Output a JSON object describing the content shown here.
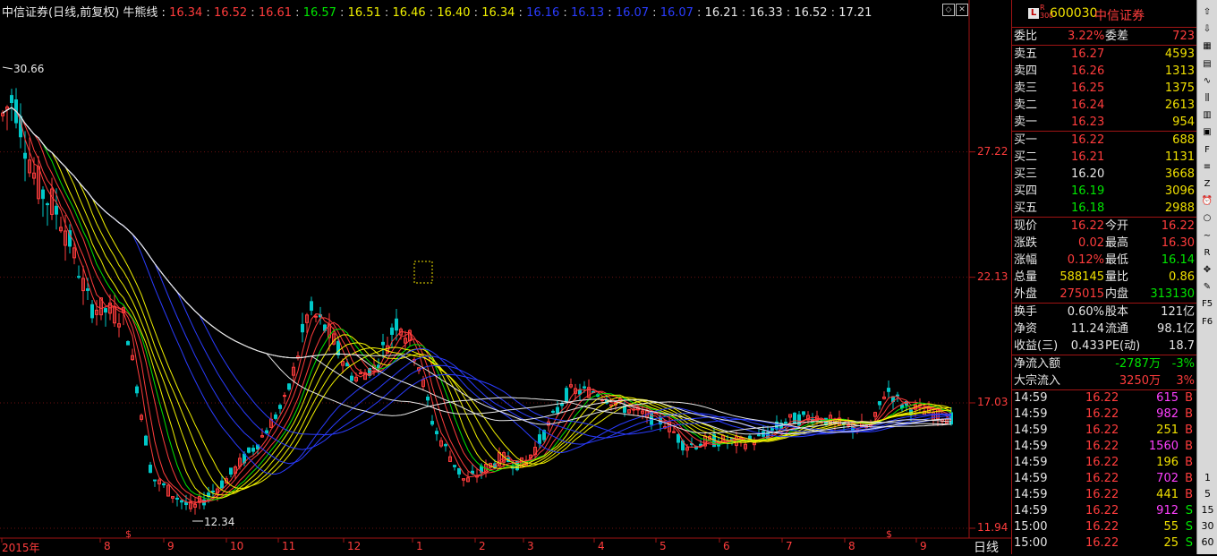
{
  "chart": {
    "legend_title": "中信证券(日线,前复权) 牛熊线 :",
    "ma_values": [
      {
        "v": "16.34",
        "color": "#ff3c3c"
      },
      {
        "v": "16.52",
        "color": "#ff3c3c"
      },
      {
        "v": "16.61",
        "color": "#ff3c3c"
      },
      {
        "v": "16.57",
        "color": "#00e600"
      },
      {
        "v": "16.51",
        "color": "#f0f000"
      },
      {
        "v": "16.46",
        "color": "#f0f000"
      },
      {
        "v": "16.40",
        "color": "#f0f000"
      },
      {
        "v": "16.34",
        "color": "#f0f000"
      },
      {
        "v": "16.16",
        "color": "#2a3cff"
      },
      {
        "v": "16.13",
        "color": "#2a3cff"
      },
      {
        "v": "16.07",
        "color": "#2a3cff"
      },
      {
        "v": "16.07",
        "color": "#2a3cff"
      },
      {
        "v": "16.21",
        "color": "#e6e6e6"
      },
      {
        "v": "16.33",
        "color": "#e6e6e6"
      },
      {
        "v": "16.52",
        "color": "#e6e6e6"
      },
      {
        "v": "17.21",
        "color": "#e6e6e6"
      }
    ],
    "high_marker": "30.66",
    "low_marker": "12.34",
    "period_label": "日线"
  },
  "chart_data": {
    "type": "candlestick",
    "y_ticks": [
      "27.22",
      "22.13",
      "17.03",
      "11.94"
    ],
    "x_ticks": [
      "2015年",
      "8",
      "9",
      "10",
      "11",
      "12",
      "1",
      "2",
      "3",
      "4",
      "5",
      "6",
      "7",
      "8",
      "9"
    ],
    "ylim": [
      11.94,
      30.66
    ],
    "markers": {
      "high": 30.66,
      "low": 12.34
    }
  },
  "quote": {
    "badge": "L",
    "badge_sub": "R 300",
    "code": "600030",
    "name": "中信证券",
    "weibi": {
      "label": "委比",
      "value": "3.22%",
      "label2": "委差",
      "value2": "723"
    },
    "sells": [
      {
        "label": "卖五",
        "price": "16.27",
        "vol": "4593"
      },
      {
        "label": "卖四",
        "price": "16.26",
        "vol": "1313"
      },
      {
        "label": "卖三",
        "price": "16.25",
        "vol": "1375"
      },
      {
        "label": "卖二",
        "price": "16.24",
        "vol": "2613"
      },
      {
        "label": "卖一",
        "price": "16.23",
        "vol": "954"
      }
    ],
    "buys": [
      {
        "label": "买一",
        "price": "16.22",
        "vol": "688",
        "pc": "red"
      },
      {
        "label": "买二",
        "price": "16.21",
        "vol": "1131",
        "pc": "red"
      },
      {
        "label": "买三",
        "price": "16.20",
        "vol": "3668",
        "pc": "white"
      },
      {
        "label": "买四",
        "price": "16.19",
        "vol": "3096",
        "pc": "green"
      },
      {
        "label": "买五",
        "price": "16.18",
        "vol": "2988",
        "pc": "green"
      }
    ],
    "stats1": [
      {
        "l1": "现价",
        "v1": "16.22",
        "c1": "red",
        "l2": "今开",
        "v2": "16.22",
        "c2": "red"
      },
      {
        "l1": "涨跌",
        "v1": "0.02",
        "c1": "red",
        "l2": "最高",
        "v2": "16.30",
        "c2": "red"
      },
      {
        "l1": "涨幅",
        "v1": "0.12%",
        "c1": "red",
        "l2": "最低",
        "v2": "16.14",
        "c2": "green"
      },
      {
        "l1": "总量",
        "v1": "588145",
        "c1": "yellow",
        "l2": "量比",
        "v2": "0.86",
        "c2": "yellow"
      },
      {
        "l1": "外盘",
        "v1": "275015",
        "c1": "red",
        "l2": "内盘",
        "v2": "313130",
        "c2": "green"
      }
    ],
    "stats2": [
      {
        "l1": "换手",
        "v1": "0.60%",
        "l2": "股本",
        "v2": "121亿"
      },
      {
        "l1": "净资",
        "v1": "11.24",
        "l2": "流通",
        "v2": "98.1亿"
      },
      {
        "l1": "收益(三)",
        "v1": "0.433",
        "l2": "PE(动)",
        "v2": "18.7"
      }
    ],
    "flows": [
      {
        "label": "净流入额",
        "value": "-2787万",
        "vc": "green",
        "pct": "-3%",
        "pc": "green"
      },
      {
        "label": "大宗流入",
        "value": "3250万",
        "vc": "red",
        "pct": "3%",
        "pc": "red"
      }
    ],
    "ticks": [
      {
        "t": "14:59",
        "p": "16.22",
        "v": "615",
        "vc": "magenta",
        "s": "B",
        "sc": "red"
      },
      {
        "t": "14:59",
        "p": "16.22",
        "v": "982",
        "vc": "magenta",
        "s": "B",
        "sc": "red"
      },
      {
        "t": "14:59",
        "p": "16.22",
        "v": "251",
        "vc": "yellow",
        "s": "B",
        "sc": "red"
      },
      {
        "t": "14:59",
        "p": "16.22",
        "v": "1560",
        "vc": "magenta",
        "s": "B",
        "sc": "red"
      },
      {
        "t": "14:59",
        "p": "16.22",
        "v": "196",
        "vc": "yellow",
        "s": "B",
        "sc": "red"
      },
      {
        "t": "14:59",
        "p": "16.22",
        "v": "702",
        "vc": "magenta",
        "s": "B",
        "sc": "red"
      },
      {
        "t": "14:59",
        "p": "16.22",
        "v": "441",
        "vc": "yellow",
        "s": "B",
        "sc": "red"
      },
      {
        "t": "14:59",
        "p": "16.22",
        "v": "912",
        "vc": "magenta",
        "s": "S",
        "sc": "green"
      },
      {
        "t": "15:00",
        "p": "16.22",
        "v": "55",
        "vc": "yellow",
        "s": "S",
        "sc": "green"
      },
      {
        "t": "15:00",
        "p": "16.22",
        "v": "25",
        "vc": "yellow",
        "s": "S",
        "sc": "green"
      }
    ]
  },
  "toolbar": {
    "periods": [
      "1",
      "5",
      "15",
      "30",
      "60"
    ],
    "icons": [
      "up-arrow-icon",
      "down-arrow-icon",
      "grid-icon",
      "list-icon",
      "chart-icon",
      "candle-icon",
      "bars-icon",
      "table-icon",
      "f10-icon",
      "news-icon",
      "fiz-icon",
      "alarm-icon",
      "circle-icon",
      "line-icon",
      "rsi-icon",
      "compass-icon",
      "pencil-icon",
      "f5-icon",
      "f6-icon"
    ]
  }
}
